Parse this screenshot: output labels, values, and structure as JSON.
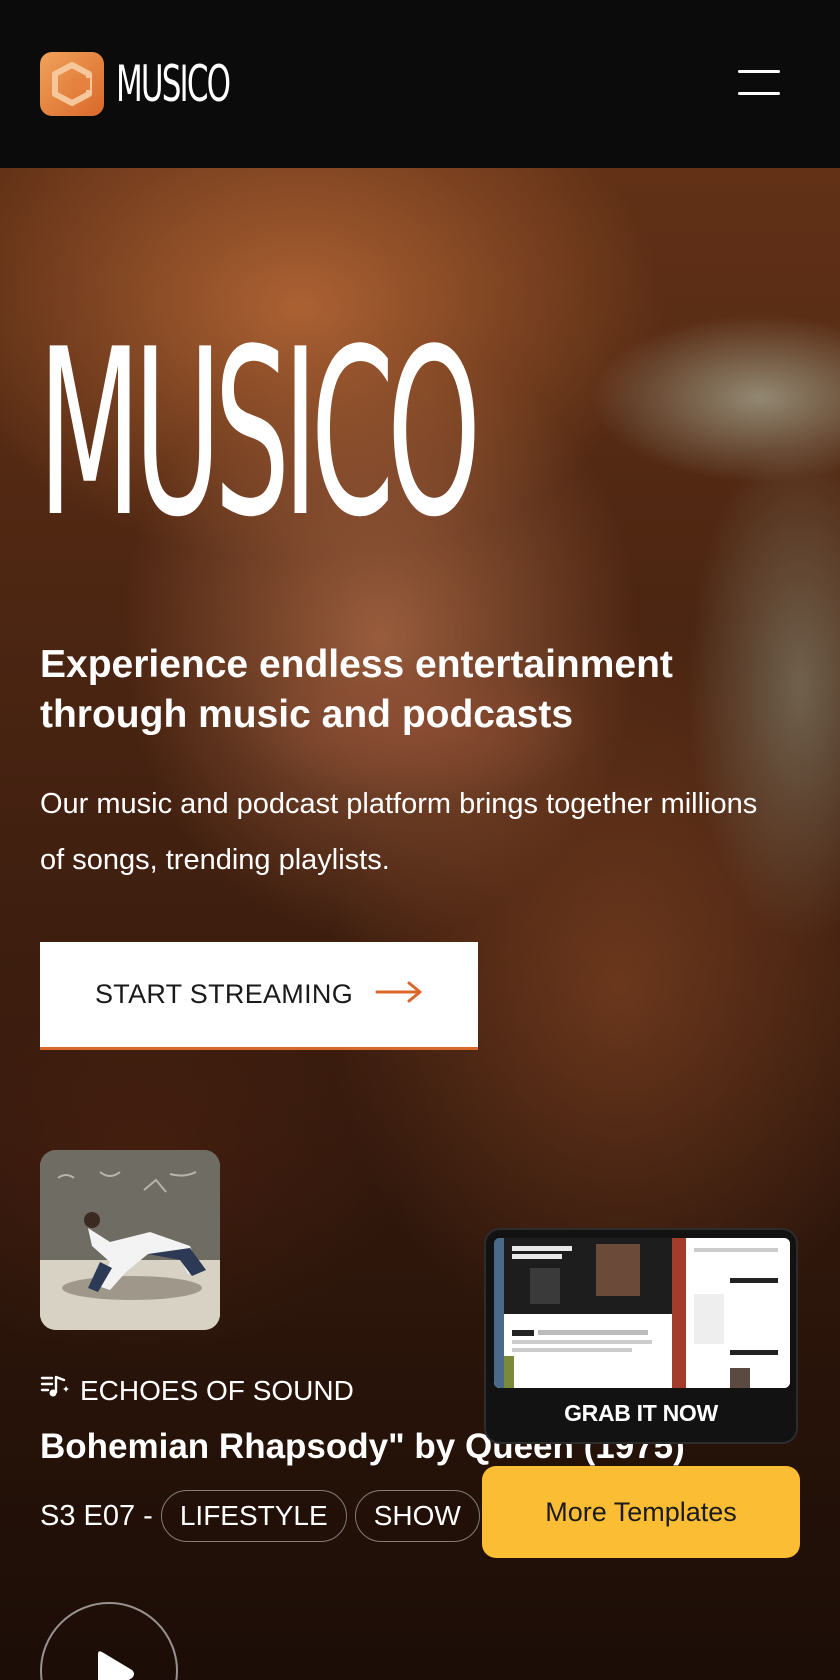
{
  "header": {
    "brand": "MUSICO",
    "logo_icon": "brand-c-logo-icon",
    "menu_icon": "hamburger-menu-icon",
    "accent_color": "#e07b39"
  },
  "hero": {
    "title": "MUSICO",
    "headline": "Experience endless entertainment through music and podcasts",
    "description": "Our music and podcast platform brings together millions of songs, trending playlists.",
    "cta_label": "START STREAMING",
    "cta_icon": "arrow-right-icon"
  },
  "episode": {
    "kicker_icon": "music-note-icon",
    "kicker": "ECHOES OF SOUND",
    "title": "Bohemian Rhapsody\" by Queen (1975)",
    "code": "S3 E07 -",
    "tags": [
      "LIFESTYLE",
      "SHOW"
    ],
    "play_icon": "play-icon"
  },
  "promo": {
    "label": "GRAB IT NOW",
    "more_label": "More Templates",
    "more_color": "#fbbd33"
  }
}
